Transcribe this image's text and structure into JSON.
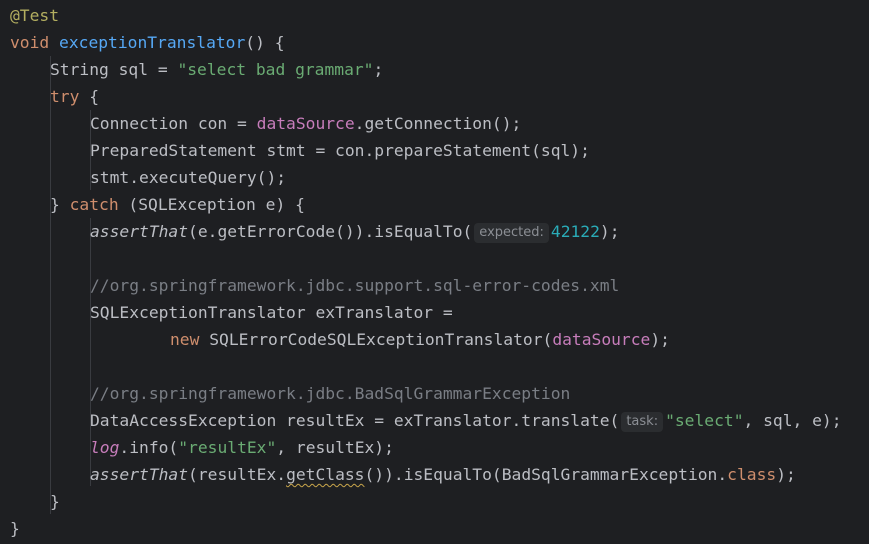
{
  "code": {
    "l1_annotation": "@Test",
    "l2_void": "void",
    "l2_method": "exceptionTranslator",
    "l2_rest": "() {",
    "l3_a": "String sql = ",
    "l3_str": "\"select bad grammar\"",
    "l3_b": ";",
    "l4_try": "try",
    "l4_brace": " {",
    "l5_a": "Connection con = ",
    "l5_field": "dataSource",
    "l5_b": ".getConnection();",
    "l6": "PreparedStatement stmt = con.prepareStatement(sql);",
    "l7": "stmt.executeQuery();",
    "l8_a": "} ",
    "l8_catch": "catch",
    "l8_b": " (SQLException e) {",
    "l9_assert": "assertThat",
    "l9_a": "(e.getErrorCode()).isEqualTo(",
    "l9_hint": "expected:",
    "l9_num": "42122",
    "l9_b": ");",
    "l11_comment": "//org.springframework.jdbc.support.sql-error-codes.xml",
    "l12": "SQLExceptionTranslator exTranslator =",
    "l13_new": "new",
    "l13_a": " SQLErrorCodeSQLExceptionTranslator(",
    "l13_field": "dataSource",
    "l13_b": ");",
    "l15_comment": "//org.springframework.jdbc.BadSqlGrammarException",
    "l16_a": "DataAccessException resultEx = exTranslator.translate(",
    "l16_hint": "task:",
    "l16_str": "\"select\"",
    "l16_b": ", sql, e);",
    "l17_log": "log",
    "l17_a": ".info(",
    "l17_str": "\"resultEx\"",
    "l17_b": ", resultEx);",
    "l18_assert": "assertThat",
    "l18_a": "(resultEx.",
    "l18_getclass": "getClass",
    "l18_b": "()).isEqualTo(BadSqlGrammarException.",
    "l18_class": "class",
    "l18_c": ");",
    "l19": "}",
    "l20": "}"
  },
  "colors": {
    "background": "#1e1f22",
    "keyword": "#cf8e6d",
    "annotation": "#b3ae60",
    "method": "#56a8f5",
    "string": "#6aab73",
    "number": "#2aacb8",
    "field": "#c77dbb",
    "comment": "#7a7e85"
  }
}
